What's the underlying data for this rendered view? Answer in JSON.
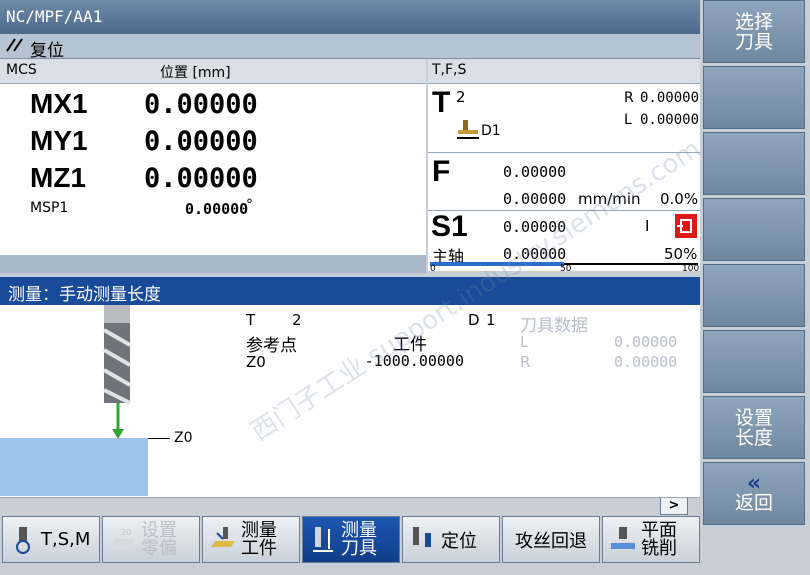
{
  "header": {
    "path": "NC/MPF/AA1",
    "status": "复位"
  },
  "mcs": {
    "title": "MCS",
    "position_label": "位置 [mm]",
    "axes": [
      {
        "name": "MX1",
        "value": "0.00000"
      },
      {
        "name": "MY1",
        "value": "0.00000"
      },
      {
        "name": "MZ1",
        "value": "0.00000"
      }
    ],
    "spindle": {
      "name": "MSP1",
      "value": "0.00000",
      "unit": "°"
    }
  },
  "tfs": {
    "title": "T,F,S",
    "tool": {
      "letter": "T",
      "number": "2",
      "d_label": "D1",
      "r_label": "R",
      "r_value": "0.00000",
      "l_label": "L",
      "l_value": "0.00000"
    },
    "feed": {
      "letter": "F",
      "value1": "0.00000",
      "value2": "0.00000",
      "unit": "mm/min",
      "percent": "0.0%"
    },
    "spindle": {
      "letter": "S1",
      "sublabel": "主轴",
      "value1": "0.00000",
      "value2": "0.00000",
      "dir": "I",
      "percent": "50%",
      "scale": [
        "0",
        "50",
        "100"
      ],
      "load_fraction": 0.5
    }
  },
  "measure": {
    "title": "测量：手动测量长度",
    "t_label": "T",
    "t_value": "2",
    "d_label": "D",
    "d_value": "1",
    "ref_label": "参考点",
    "ref_value": "工件",
    "z0_label": "Z0",
    "z0_value": "-1000.00000",
    "tool_data_title": "刀具数据",
    "l_label": "L",
    "l_value": "0.00000",
    "r_label": "R",
    "r_value": "0.00000",
    "diagram_z0": "Z0",
    "scroll_btn": ">"
  },
  "right_softkeys": [
    {
      "label": "选择\n刀具"
    },
    {
      "label": ""
    },
    {
      "label": ""
    },
    {
      "label": ""
    },
    {
      "label": ""
    },
    {
      "label": ""
    },
    {
      "label": "设置\n长度"
    },
    {
      "label": "返回",
      "icon": "«"
    }
  ],
  "bottom_softkeys": [
    {
      "label": "T,S,M"
    },
    {
      "label": "设置\n零偏"
    },
    {
      "label": "测量\n工件"
    },
    {
      "label": "测量\n刀具"
    },
    {
      "label": "定位"
    },
    {
      "label": "攻丝回退"
    },
    {
      "label": "平面\n铣削"
    }
  ],
  "watermark": "西门子工业 support.industry.siemens.com",
  "colors": {
    "accent": "#1a4a9a",
    "header": "#4d6a8c",
    "softkey": "#7d93aa",
    "direction_red": "#e01818",
    "tool_green": "#2fa82f",
    "workpiece": "#9ec5ec"
  }
}
